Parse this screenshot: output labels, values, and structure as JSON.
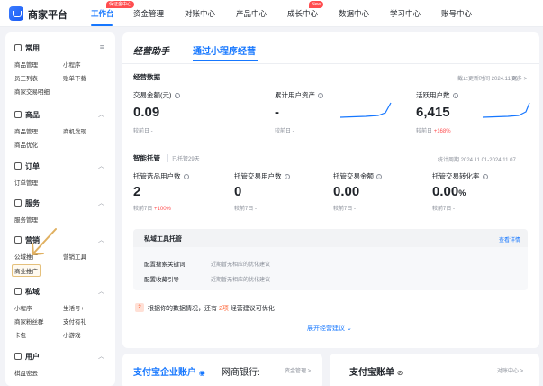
{
  "topnav": {
    "brand": "商家平台",
    "items": [
      {
        "label": "工作台",
        "active": true
      },
      {
        "label": "资金管理"
      },
      {
        "label": "对账中心"
      },
      {
        "label": "产品中心"
      },
      {
        "label": "成长中心"
      },
      {
        "label": "数据中心"
      },
      {
        "label": "学习中心"
      },
      {
        "label": "账号中心"
      }
    ],
    "badges": {
      "workbench": "保证金中心",
      "growth": "New"
    }
  },
  "sidebar": {
    "common": {
      "title": "常用",
      "items": [
        "商品管理",
        "小程序",
        "员工列表",
        "账单下载",
        "商家交易明细"
      ]
    },
    "goods": {
      "title": "商品",
      "items": [
        "商品管理",
        "商机发现",
        "商品优化"
      ]
    },
    "order": {
      "title": "订单",
      "items": [
        "订单管理"
      ]
    },
    "service": {
      "title": "服务",
      "items": [
        "服务管理"
      ]
    },
    "marketing": {
      "title": "营销",
      "items": [
        "公域推广",
        "营销工具",
        "商业推广"
      ]
    },
    "private": {
      "title": "私域",
      "items": [
        "小程序",
        "生活号+",
        "商家粉丝群",
        "支付有礼",
        "卡包",
        "小游戏"
      ]
    },
    "user": {
      "title": "用户",
      "items": [
        "棋盘密云"
      ]
    }
  },
  "main": {
    "tab1": "经营助手",
    "tab2": "通过小程序经营",
    "section_data": "经营数据",
    "updated": "截止更新时间 2024.11.06",
    "more": "更多 >",
    "metrics": [
      {
        "label": "交易金额(元)",
        "value": "0.09",
        "sub": "较前日 -",
        "change": ""
      },
      {
        "label": "累计用户资产",
        "value": "-",
        "sub": "较前日 -",
        "change": ""
      },
      {
        "label": "活跃用户数",
        "value": "6,415",
        "sub": "较前日",
        "change": "+168%"
      }
    ],
    "section_trust": "智能托管",
    "trust_days": "已托管29天",
    "period": "统计周期 2024.11.01-2024.11.07",
    "trust_metrics": [
      {
        "label": "托管选品用户数",
        "value": "2",
        "sub": "较前7日",
        "change": "+100%"
      },
      {
        "label": "托管交易用户数",
        "value": "0",
        "sub": "较前7日 -",
        "change": ""
      },
      {
        "label": "托管交易金额",
        "value": "0.00",
        "sub": "较前7日 -",
        "change": ""
      },
      {
        "label": "托管交易转化率",
        "value": "0.00",
        "unit": "%",
        "sub": "较前7日 -",
        "change": ""
      }
    ],
    "tools_title": "私域工具托管",
    "tools_detail": "查看详情",
    "tools": [
      {
        "name": "配置搜索关键词",
        "desc": "近期暂无相应的优化建议"
      },
      {
        "name": "配置收藏引导",
        "desc": "近期暂无相应的优化建议"
      }
    ],
    "tip_pre": "根据你的数据情况，还有",
    "tip_count": "2项",
    "tip_post": "经营建议可优化",
    "expand": "展开经营建议 ⌄"
  },
  "bottom": {
    "card1_title": "支付宝企业账户",
    "card1_sub": "网商银行:",
    "card1_link": "资金管理 >",
    "card2_title": "支付宝账单",
    "card2_link": "对账中心 >"
  },
  "colors": {
    "accent": "#1677ff",
    "red": "#ff4d4f"
  }
}
